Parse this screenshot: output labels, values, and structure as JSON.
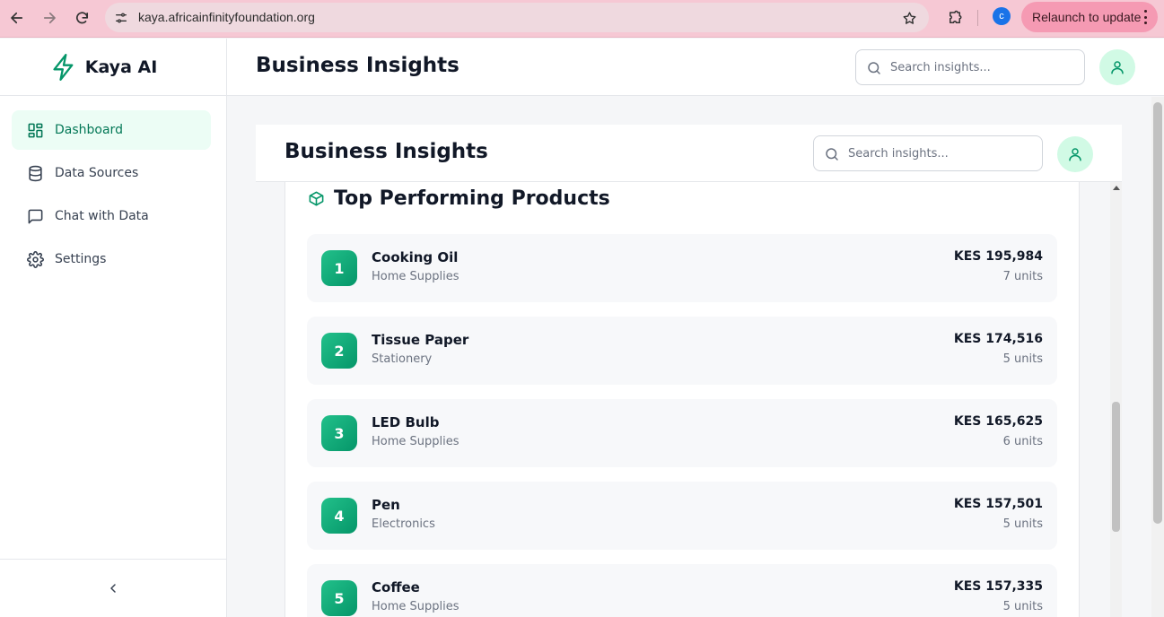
{
  "browser": {
    "url": "kaya.africainfinityfoundation.org",
    "profile_initial": "c",
    "relaunch_label": "Relaunch to update"
  },
  "sidebar": {
    "brand": "Kaya AI",
    "items": [
      {
        "label": "Dashboard",
        "icon": "dashboard-icon",
        "active": true
      },
      {
        "label": "Data Sources",
        "icon": "database-icon",
        "active": false
      },
      {
        "label": "Chat with Data",
        "icon": "chat-icon",
        "active": false
      },
      {
        "label": "Settings",
        "icon": "gear-icon",
        "active": false
      }
    ]
  },
  "header": {
    "title": "Business Insights",
    "search_placeholder": "Search insights..."
  },
  "inner_header": {
    "title": "Business Insights",
    "search_placeholder": "Search insights..."
  },
  "top_products": {
    "title": "Top Performing Products",
    "items": [
      {
        "rank": "1",
        "name": "Cooking Oil",
        "category": "Home Supplies",
        "revenue": "KES 195,984",
        "units": "7 units"
      },
      {
        "rank": "2",
        "name": "Tissue Paper",
        "category": "Stationery",
        "revenue": "KES 174,516",
        "units": "5 units"
      },
      {
        "rank": "3",
        "name": "LED Bulb",
        "category": "Home Supplies",
        "revenue": "KES 165,625",
        "units": "6 units"
      },
      {
        "rank": "4",
        "name": "Pen",
        "category": "Electronics",
        "revenue": "KES 157,501",
        "units": "5 units"
      },
      {
        "rank": "5",
        "name": "Coffee",
        "category": "Home Supplies",
        "revenue": "KES 157,335",
        "units": "5 units"
      }
    ]
  },
  "colors": {
    "accent": "#059669",
    "accent_light": "#d1fae5",
    "active_bg": "#ecfdf5",
    "chrome_bg": "#f6c8d4"
  }
}
